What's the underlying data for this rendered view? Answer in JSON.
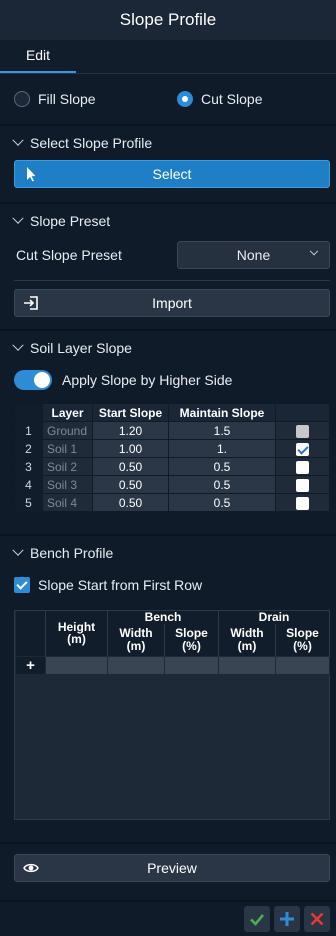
{
  "title": "Slope Profile",
  "tab": "Edit",
  "slope_type": {
    "fill": "Fill Slope",
    "cut": "Cut Slope",
    "selected": "cut"
  },
  "select_section": {
    "header": "Select Slope Profile",
    "button": "Select"
  },
  "preset_section": {
    "header": "Slope Preset",
    "label": "Cut Slope Preset",
    "value": "None",
    "import_button": "Import"
  },
  "soil_section": {
    "header": "Soil Layer Slope",
    "toggle_label": "Apply Slope by Higher Side",
    "toggle_on": true,
    "columns": [
      "Layer",
      "Start Slope",
      "Maintain Slope"
    ],
    "rows": [
      {
        "idx": "1",
        "layer": "Ground",
        "start": "1.20",
        "maintain": "1.5",
        "checked": false,
        "disabled": true
      },
      {
        "idx": "2",
        "layer": "Soil 1",
        "start": "1.00",
        "maintain": "1.",
        "checked": true,
        "disabled": false
      },
      {
        "idx": "3",
        "layer": "Soil 2",
        "start": "0.50",
        "maintain": "0.5",
        "checked": false,
        "disabled": false
      },
      {
        "idx": "4",
        "layer": "Soil 3",
        "start": "0.50",
        "maintain": "0.5",
        "checked": false,
        "disabled": false
      },
      {
        "idx": "5",
        "layer": "Soil 4",
        "start": "0.50",
        "maintain": "0.5",
        "checked": false,
        "disabled": false
      }
    ]
  },
  "bench_section": {
    "header": "Bench Profile",
    "checkbox_label": "Slope Start from First Row",
    "checkbox_checked": true,
    "col_height": "Height",
    "col_height_unit": "(m)",
    "group_bench": "Bench",
    "group_drain": "Drain",
    "col_width": "Width",
    "col_width_unit": "(m)",
    "col_slope": "Slope",
    "col_slope_unit": "(%)",
    "add_row": "+"
  },
  "preview_button": "Preview",
  "colors": {
    "accent": "#2e8bd6",
    "ok": "#4caf50",
    "cancel": "#e53935"
  },
  "icons": [
    "chevron-down-icon",
    "cursor-arrow-icon",
    "import-icon",
    "eye-icon",
    "check-icon",
    "plus-icon",
    "close-icon"
  ]
}
